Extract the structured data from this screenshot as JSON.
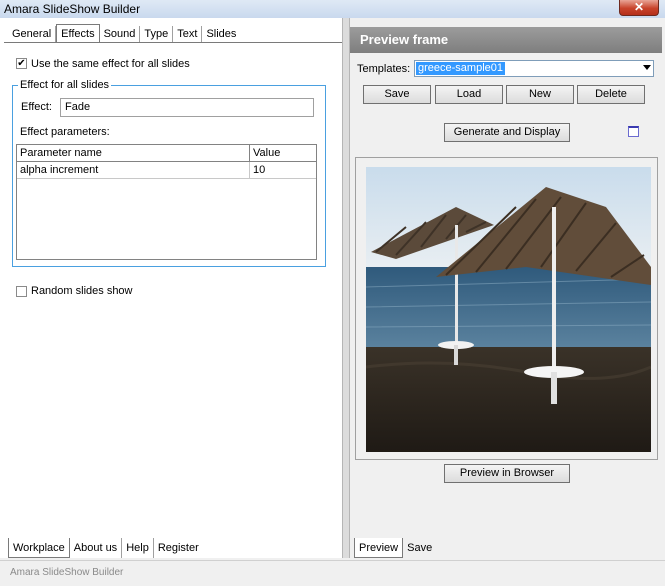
{
  "window": {
    "title": "Amara SlideShow Builder",
    "close_glyph": "✕"
  },
  "left": {
    "tabs": [
      "General",
      "Effects",
      "Sound",
      "Type",
      "Text",
      "Slides"
    ],
    "active_tab": "Effects",
    "same_effect_label": "Use the same effect for all slides",
    "same_effect_checked": true,
    "group_label": "Effect for all slides",
    "effect_label": "Effect:",
    "effect_value": "Fade",
    "params_label": "Effect parameters:",
    "table": {
      "headers": [
        "Parameter name",
        "Value"
      ],
      "rows": [
        {
          "name": "alpha increment",
          "value": "10"
        }
      ]
    },
    "random_label": "Random slides show",
    "random_checked": false,
    "bottom_tabs": [
      "Workplace",
      "About us",
      "Help",
      "Register"
    ]
  },
  "right": {
    "title": "Preview frame",
    "templates_label": "Templates:",
    "templates_value": "greece-sample01",
    "buttons": {
      "save": "Save",
      "load": "Load",
      "new": "New",
      "delete": "Delete"
    },
    "generate": "Generate and Display",
    "preview_browser": "Preview in Browser",
    "bottom_tabs": [
      "Preview",
      "Save"
    ]
  },
  "status": {
    "text": "Amara SlideShow Builder"
  },
  "colors": {
    "accent": "#3399ff",
    "group_border": "#4aa0e0",
    "header": "#8c8c8c"
  }
}
